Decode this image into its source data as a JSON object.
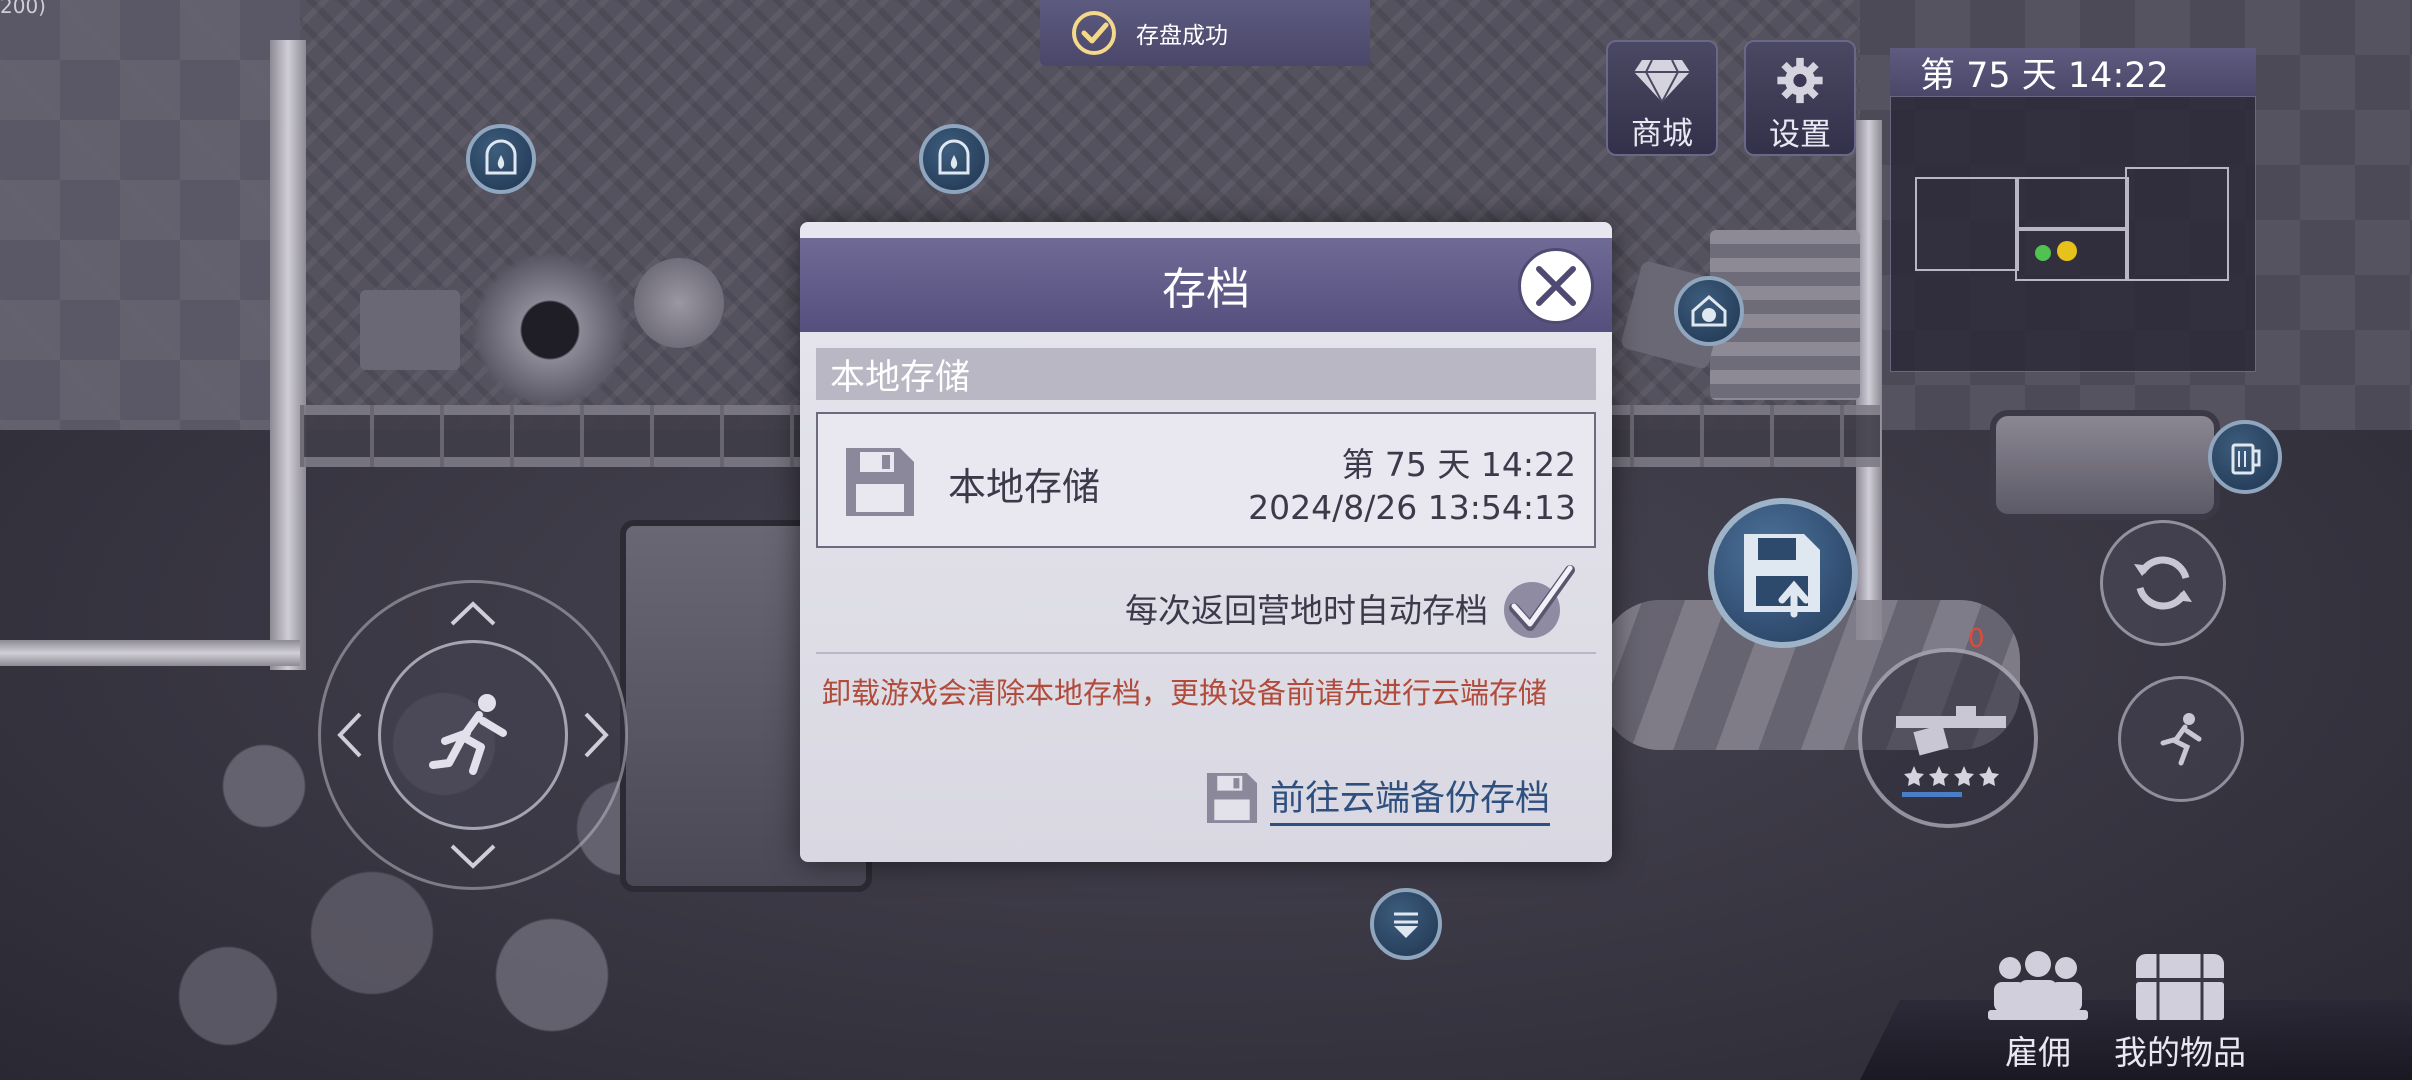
{
  "debug": {
    "coord_text": "200)"
  },
  "toast": {
    "text": "存盘成功"
  },
  "top_buttons": {
    "shop_label": "商城",
    "settings_label": "设置"
  },
  "minimap": {
    "day_time": "第 75 天  14:22"
  },
  "dialog": {
    "title": "存档",
    "section_title": "本地存储",
    "slot": {
      "name": "本地存储",
      "day_time": "第 75 天  14:22",
      "saved_at": "2024/8/26 13:54:13"
    },
    "autosave_label": "每次返回营地时自动存档",
    "autosave_checked": true,
    "warning": "卸载游戏会清除本地存档，更换设备前请先进行云端存储",
    "cloud_link": "前往云端备份存档"
  },
  "weapon": {
    "ammo": "0",
    "stars": 4
  },
  "bottom_buttons": {
    "hire_label": "雇佣",
    "items_label": "我的物品"
  },
  "colors": {
    "header_purple": "#5d5891",
    "warning_red": "#b14b3b",
    "link_blue": "#2f4f7e",
    "ammo_red": "#e04a3a"
  },
  "icons": {
    "toast": "check-circle-icon",
    "shop": "diamond-icon",
    "settings": "gear-icon",
    "close": "close-icon",
    "slot": "floppy-disk-icon",
    "autosave": "checkmark-icon",
    "cloud": "floppy-disk-icon",
    "joystick": "running-man-icon",
    "save": "save-upload-icon",
    "hire": "people-icon",
    "items": "chest-icon"
  }
}
